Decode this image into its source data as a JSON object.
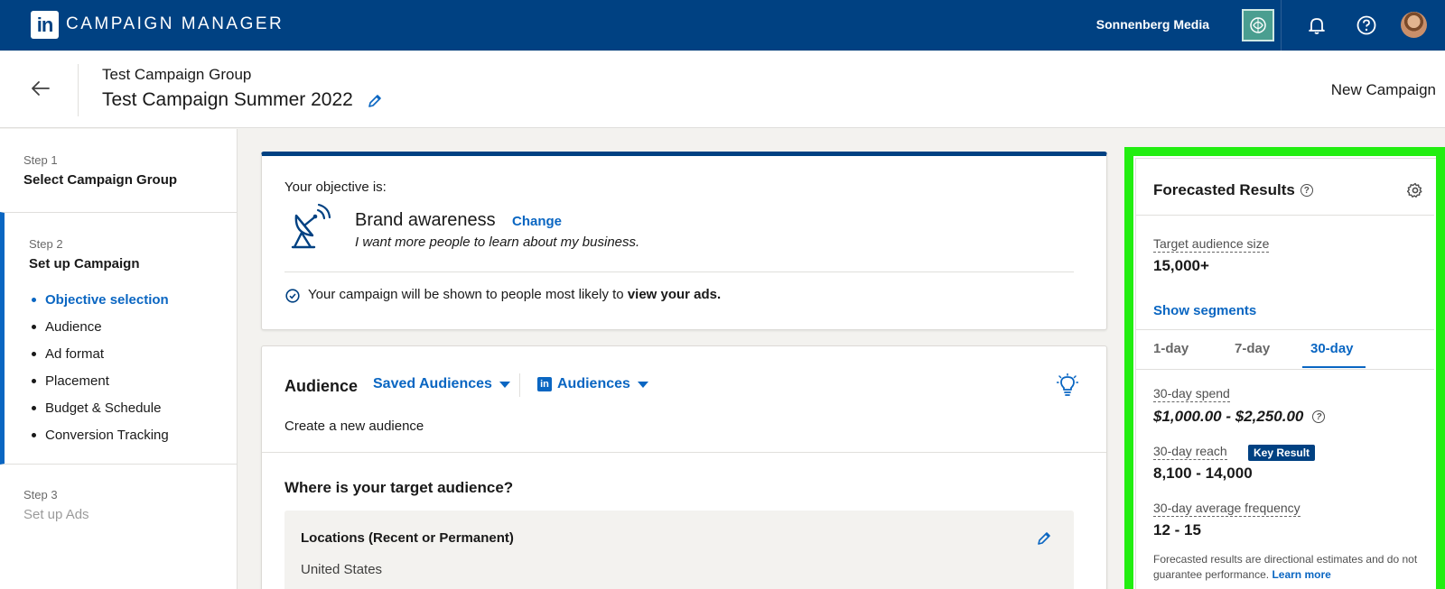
{
  "nav": {
    "logo_text": "in",
    "app_name": "CAMPAIGN MANAGER",
    "account_name": "Sonnenberg Media",
    "icons": [
      "bell-icon",
      "help-icon",
      "avatar"
    ],
    "color": "#004182"
  },
  "header": {
    "group_name": "Test Campaign Group",
    "campaign_name": "Test Campaign Summer 2022",
    "new_campaign": "New Campaign"
  },
  "steps": {
    "step1": {
      "num": "Step 1",
      "title": "Select Campaign Group"
    },
    "step2": {
      "num": "Step 2",
      "title": "Set up Campaign",
      "items": [
        {
          "label": "Objective selection",
          "active": true
        },
        {
          "label": "Audience"
        },
        {
          "label": "Ad format"
        },
        {
          "label": "Placement"
        },
        {
          "label": "Budget & Schedule"
        },
        {
          "label": "Conversion Tracking"
        }
      ]
    },
    "step3": {
      "num": "Step 3",
      "title": "Set up Ads"
    }
  },
  "objective": {
    "label": "Your objective is:",
    "name": "Brand awareness",
    "change": "Change",
    "description": "I want more people to learn about my business.",
    "info_prefix": "Your campaign will be shown to people most likely to ",
    "info_bold": "view your ads."
  },
  "audience": {
    "title": "Audience",
    "saved_audiences": "Saved Audiences",
    "audiences": "Audiences",
    "create": "Create a new audience",
    "where": "Where is your target audience?",
    "locations_title": "Locations (Recent or Permanent)",
    "locations_value": "United States"
  },
  "forecast": {
    "title": "Forecasted Results",
    "audience_size_label": "Target audience size",
    "audience_size_value": "15,000+",
    "show_segments": "Show segments",
    "tabs": [
      "1-day",
      "7-day",
      "30-day"
    ],
    "active_tab": "30-day",
    "spend_label": "30-day spend",
    "spend_value": "$1,000.00 - $2,250.00",
    "reach_label": "30-day reach",
    "reach_badge": "Key Result",
    "reach_value": "8,100 - 14,000",
    "freq_label": "30-day average frequency",
    "freq_value": "12 - 15",
    "note": "Forecasted results are directional estimates and do not guarantee performance.",
    "learn_more": "Learn more",
    "highlight_color": "#22ee11"
  }
}
